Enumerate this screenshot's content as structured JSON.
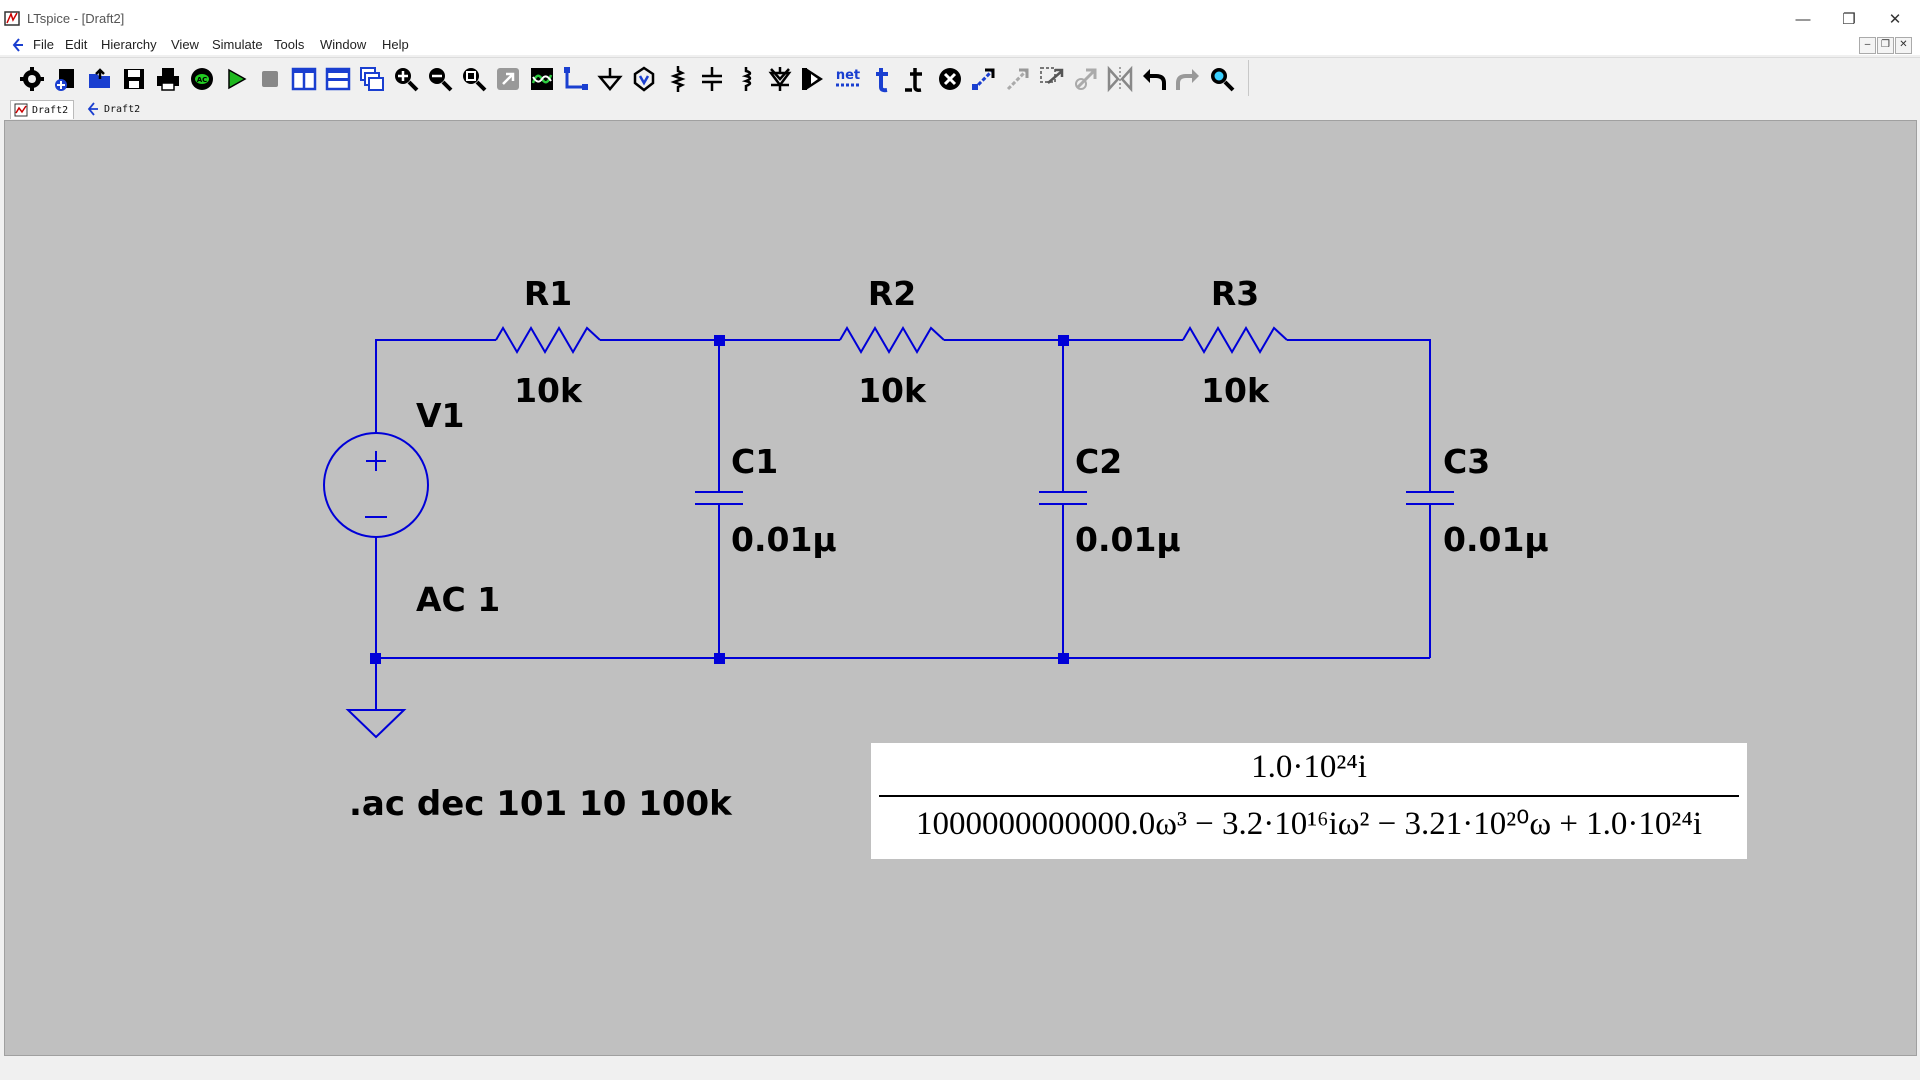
{
  "window": {
    "title": "LTspice - [Draft2]",
    "controls": {
      "minimize": "—",
      "restore": "❐",
      "close": "✕"
    }
  },
  "menu": {
    "items": [
      "File",
      "Edit",
      "Hierarchy",
      "View",
      "Simulate",
      "Tools",
      "Window",
      "Help"
    ],
    "mdi_controls": [
      "–",
      "❐",
      "✕"
    ]
  },
  "toolbar": {
    "net_label": "net",
    "icons": [
      "gear-icon",
      "new-schematic-icon",
      "open-icon",
      "save-icon",
      "print-icon",
      "control-panel-icon",
      "run-icon",
      "halt-icon",
      "tile-vertical-icon",
      "tile-horizontal-icon",
      "cascade-icon",
      "zoom-in-icon",
      "zoom-out-icon",
      "zoom-fit-icon",
      "zoom-back-icon",
      "autorange-icon",
      "wire-icon",
      "ground-icon",
      "label-icon",
      "resistor-icon",
      "capacitor-icon",
      "inductor-icon",
      "diode-icon",
      "component-icon",
      "net-label-icon",
      "spice-directive-icon",
      "text-icon",
      "delete-icon",
      "duplicate-icon",
      "move-icon",
      "drag-icon",
      "rotate-icon",
      "mirror-icon",
      "undo-icon",
      "redo-icon",
      "find-icon"
    ]
  },
  "tabs": [
    {
      "label": "Draft2",
      "icon": "waveform-icon",
      "active": true
    },
    {
      "label": "Draft2",
      "icon": "schematic-icon",
      "active": false
    }
  ],
  "schematic": {
    "resistors": [
      {
        "name": "R1",
        "value": "10k"
      },
      {
        "name": "R2",
        "value": "10k"
      },
      {
        "name": "R3",
        "value": "10k"
      }
    ],
    "capacitors": [
      {
        "name": "C1",
        "value": "0.01μ"
      },
      {
        "name": "C2",
        "value": "0.01μ"
      },
      {
        "name": "C3",
        "value": "0.01μ"
      }
    ],
    "source": {
      "name": "V1",
      "value": "AC 1"
    },
    "directive": ".ac dec 101 10 100k",
    "wire_color": "#0000d8",
    "canvas_color": "#c0c0c0"
  },
  "formula": {
    "numerator": "1.0·10²⁴i",
    "denominator": "1000000000000.0ω³ − 3.2·10¹⁶iω² − 3.21·10²⁰ω + 1.0·10²⁴i"
  }
}
